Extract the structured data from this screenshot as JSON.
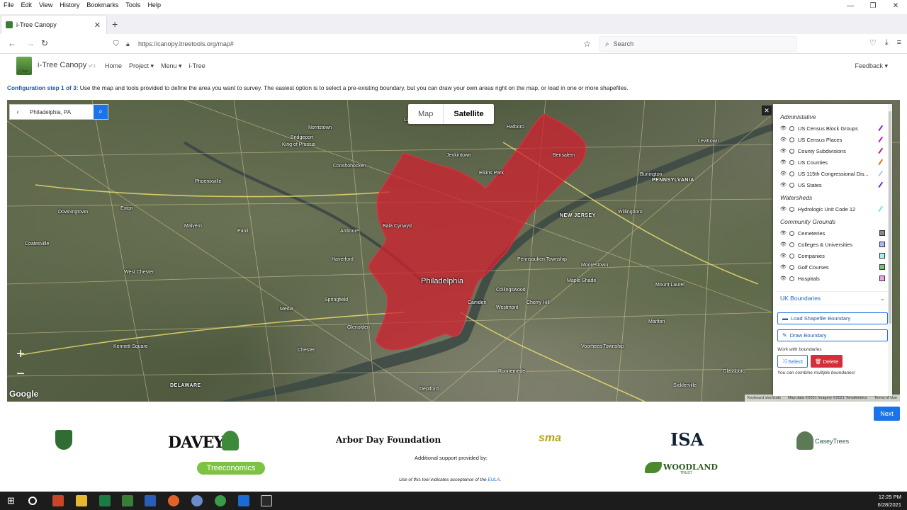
{
  "browser": {
    "menu": [
      "File",
      "Edit",
      "View",
      "History",
      "Bookmarks",
      "Tools",
      "Help"
    ],
    "tab_title": "i-Tree Canopy",
    "url": "https://canopy.itreetools.org/map#",
    "search_placeholder": "Search"
  },
  "site": {
    "brand": "i-Tree Canopy",
    "version": "v7.1",
    "logo_sub": "i-Tree",
    "nav": [
      "Home",
      "Project ▾",
      "Menu ▾",
      "i-Tree"
    ],
    "feedback": "Feedback ▾"
  },
  "config": {
    "step": "Configuration step 1 of 3:",
    "text": " Use the map and tools provided to define the area you want to survey. The easiest option is to select a pre-existing boundary, but you can draw your own areas right on the map, or load in one or more shapefiles."
  },
  "map": {
    "search_value": "Philadelphia, PA",
    "type_map": "Map",
    "type_satellite": "Satellite",
    "google": "Google",
    "attribution": [
      "Keyboard shortcuts",
      "Map data ©2021 Imagery ©2021 TerraMetrics",
      "Terms of Use"
    ],
    "labels": [
      "Philadelphia",
      "Camden",
      "Norristown",
      "King of Prussia",
      "Bridgeport",
      "Conshohocken",
      "Ardmore",
      "Bala Cynwyd",
      "Haverford",
      "Springfield",
      "Media",
      "Chester",
      "West Chester",
      "Glenolden",
      "Pennsauken Township",
      "Cherry Hill",
      "Moorestown",
      "Willingboro",
      "Mount Laurel",
      "Marlton",
      "Voorhees Township",
      "Deptford",
      "Runnemede",
      "Westmont",
      "Sicklerville",
      "Burlington",
      "Levittown",
      "Phoenixville",
      "Exton",
      "Malvern",
      "Paoli",
      "Downingtown",
      "Coatesville",
      "Kennett Square",
      "Bensalem",
      "Jenkintown",
      "Elkins Park",
      "Maple Shade",
      "Collingswood",
      "Glassboro",
      "Hatboro",
      "Lansdale"
    ],
    "state_labels": [
      "PENNSYLVANIA",
      "NEW JERSEY",
      "DELAWARE"
    ],
    "colors": {
      "boundary": "#d0202f"
    }
  },
  "panel": {
    "sec_admin": "Administative",
    "admin_layers": [
      {
        "name": "US Census Block Groups",
        "color": "#7a2ad8"
      },
      {
        "name": "US Census Places",
        "color": "#c020b0"
      },
      {
        "name": "County Subdivisions",
        "color": "#c0207a"
      },
      {
        "name": "US Counties",
        "color": "#e07020"
      },
      {
        "name": "US 115th Congressional Dis...",
        "color": "#b0c8e8"
      },
      {
        "name": "US States",
        "color": "#7a2ad8"
      }
    ],
    "sec_water": "Watersheds",
    "water_layers": [
      {
        "name": "Hydrologic Unit Code 12",
        "color": "#70e8d8"
      }
    ],
    "sec_community": "Community Grounds",
    "community_layers": [
      {
        "name": "Cemeteries",
        "color": "#8a8a8a"
      },
      {
        "name": "Colleges & Universities",
        "color": "#a8b8f8"
      },
      {
        "name": "Companies",
        "color": "#a8f0f0"
      },
      {
        "name": "Golf Courses",
        "color": "#70c870"
      },
      {
        "name": "Hospitals",
        "color": "#f0a0f0"
      }
    ],
    "uk_boundaries": "UK Boundaries",
    "load_shapefile": "Load Shapefile Boundary",
    "draw_boundary": "Draw Boundary",
    "work_note": "Work with boundaries",
    "select": "Select",
    "delete": "Delete",
    "combine_note": "You can combine multiple boundaries!"
  },
  "footer": {
    "next": "Next",
    "davey": "DAVEY",
    "arbor": "Arbor Day Foundation",
    "sma": "sma",
    "isa": "ISA",
    "casey": "CaseyTrees",
    "treeco": "Treeconomics",
    "woodland": "WOODLAND",
    "woodland_sub": "TRUST",
    "support": "Additional support provided by:",
    "eula_pre": "Use of this tool indicates acceptance of the ",
    "eula_link": "EULA",
    "eula_post": "."
  },
  "taskbar": {
    "time": "12:25 PM",
    "date": "6/28/2021"
  }
}
